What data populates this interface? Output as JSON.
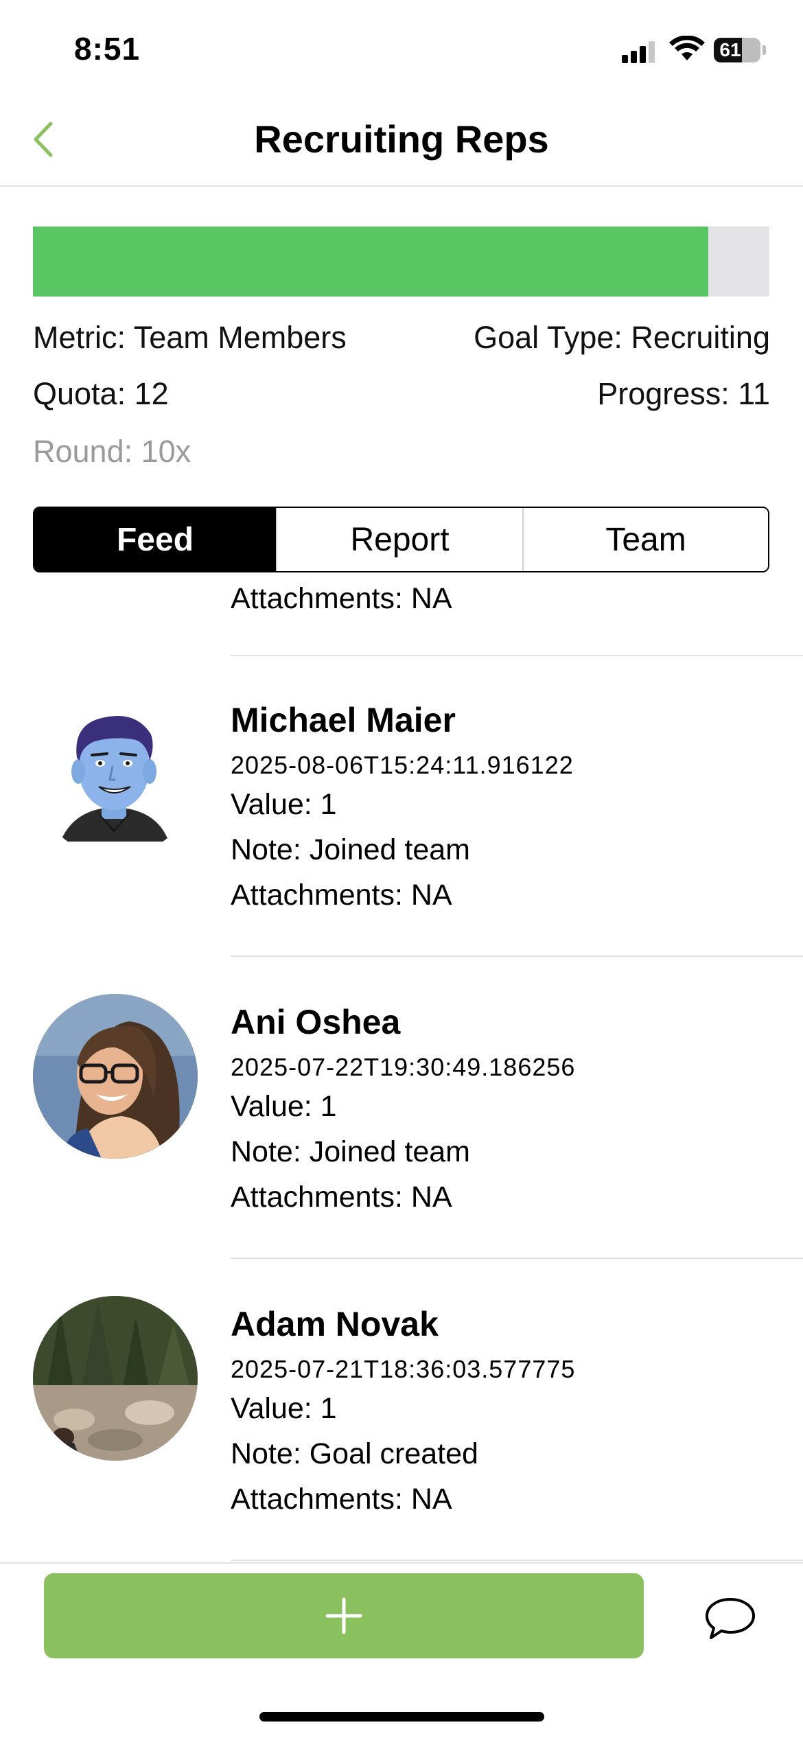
{
  "status_bar": {
    "time": "8:51",
    "battery_level": "61",
    "battery_fraction": 0.61
  },
  "nav": {
    "title": "Recruiting Reps",
    "back_icon": "chevron-left-icon"
  },
  "goal": {
    "progress_value": 11,
    "quota_value": 12,
    "progress_fraction": 0.9167,
    "metric": "Metric: Team Members",
    "goal_type": "Goal Type: Recruiting",
    "quota": "Quota: 12",
    "progress": "Progress: 11",
    "round": "Round: 10x"
  },
  "tabs": [
    {
      "label": "Feed",
      "active": true
    },
    {
      "label": "Report",
      "active": false
    },
    {
      "label": "Team",
      "active": false
    }
  ],
  "feed": {
    "partial_item": {
      "attachments": "Attachments: NA"
    },
    "items": [
      {
        "name": "Michael Maier",
        "timestamp": "2025-08-06T15:24:11.916122",
        "value": "Value: 1",
        "note": "Note: Joined team",
        "attachments": "Attachments: NA"
      },
      {
        "name": "Ani Oshea",
        "timestamp": "2025-07-22T19:30:49.186256",
        "value": "Value: 1",
        "note": "Note: Joined team",
        "attachments": "Attachments: NA"
      },
      {
        "name": "Adam Novak",
        "timestamp": "2025-07-21T18:36:03.577775",
        "value": "Value: 1",
        "note": "Note: Goal created",
        "attachments": "Attachments: NA"
      }
    ]
  },
  "bottom": {
    "add_icon": "plus-icon",
    "chat_icon": "chat-bubble-icon"
  },
  "colors": {
    "progress_fill": "#5ac663",
    "progress_track": "#e4e4e7",
    "accent_green": "#8bc05f",
    "back_chevron": "#8bc05f",
    "muted_text": "#9a9a9a"
  }
}
